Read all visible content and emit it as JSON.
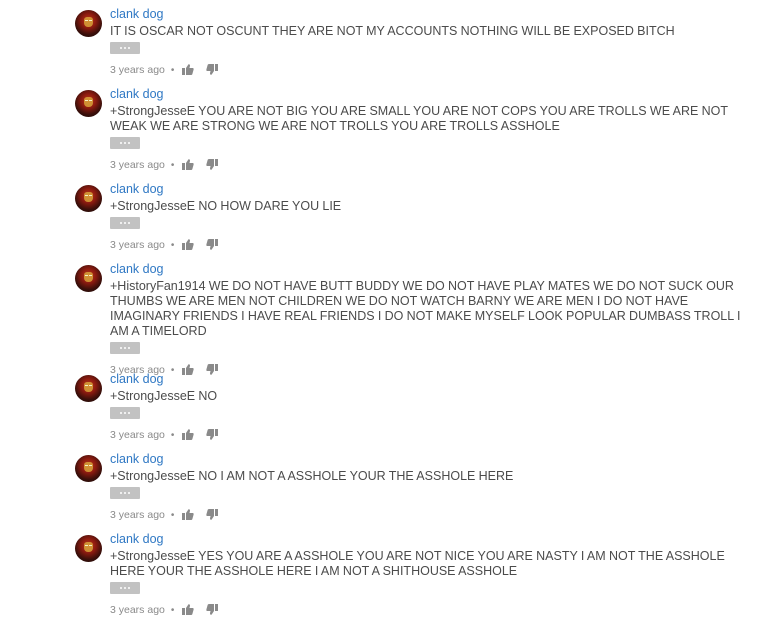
{
  "comments": [
    {
      "author": "clank dog",
      "text": "IT IS OSCAR NOT OSCUNT THEY ARE NOT MY ACCOUNTS NOTHING WILL BE EXPOSED BITCH",
      "time": "3 years ago"
    },
    {
      "author": "clank dog",
      "text": "+StrongJesseE YOU ARE NOT BIG YOU ARE SMALL YOU ARE NOT COPS YOU ARE TROLLS WE ARE NOT WEAK WE ARE STRONG WE ARE NOT TROLLS YOU ARE TROLLS ASSHOLE",
      "time": "3 years ago"
    },
    {
      "author": "clank dog",
      "text": "+StrongJesseE NO HOW DARE YOU LIE",
      "time": "3 years ago"
    },
    {
      "author": "clank dog",
      "text": "+HistoryFan1914 WE DO NOT HAVE BUTT BUDDY WE DO NOT HAVE PLAY MATES WE DO NOT SUCK OUR THUMBS WE ARE MEN NOT CHILDREN WE DO NOT WATCH BARNY WE ARE MEN I DO NOT HAVE IMAGINARY FRIENDS I HAVE REAL FRIENDS I DO NOT MAKE MYSELF LOOK POPULAR DUMBASS TROLL I AM A TIMELORD",
      "time": "3 years ago"
    },
    {
      "author": "clank dog",
      "text": "+StrongJesseE NO",
      "time": "3 years ago"
    },
    {
      "author": "clank dog",
      "text": "+StrongJesseE NO I AM NOT A ASSHOLE YOUR THE ASSHOLE HERE",
      "time": "3 years ago"
    },
    {
      "author": "clank dog",
      "text": "+StrongJesseE YES YOU ARE A ASSHOLE YOU ARE NOT NICE YOU ARE NASTY I AM NOT THE ASSHOLE HERE YOUR THE ASSHOLE HERE I AM NOT A SHITHOUSE ASSHOLE",
      "time": "3 years ago"
    }
  ],
  "meta_separator": "•",
  "icons": {
    "like": "thumbs-up-icon",
    "dislike": "thumbs-down-icon",
    "more": "more-dots-icon"
  },
  "colors": {
    "author_link": "#2f78c4",
    "comment_text": "#4b4b4b",
    "meta_text": "#8a8a8a",
    "more_button": "#c2c2c2",
    "icon": "#8a8a8a"
  }
}
